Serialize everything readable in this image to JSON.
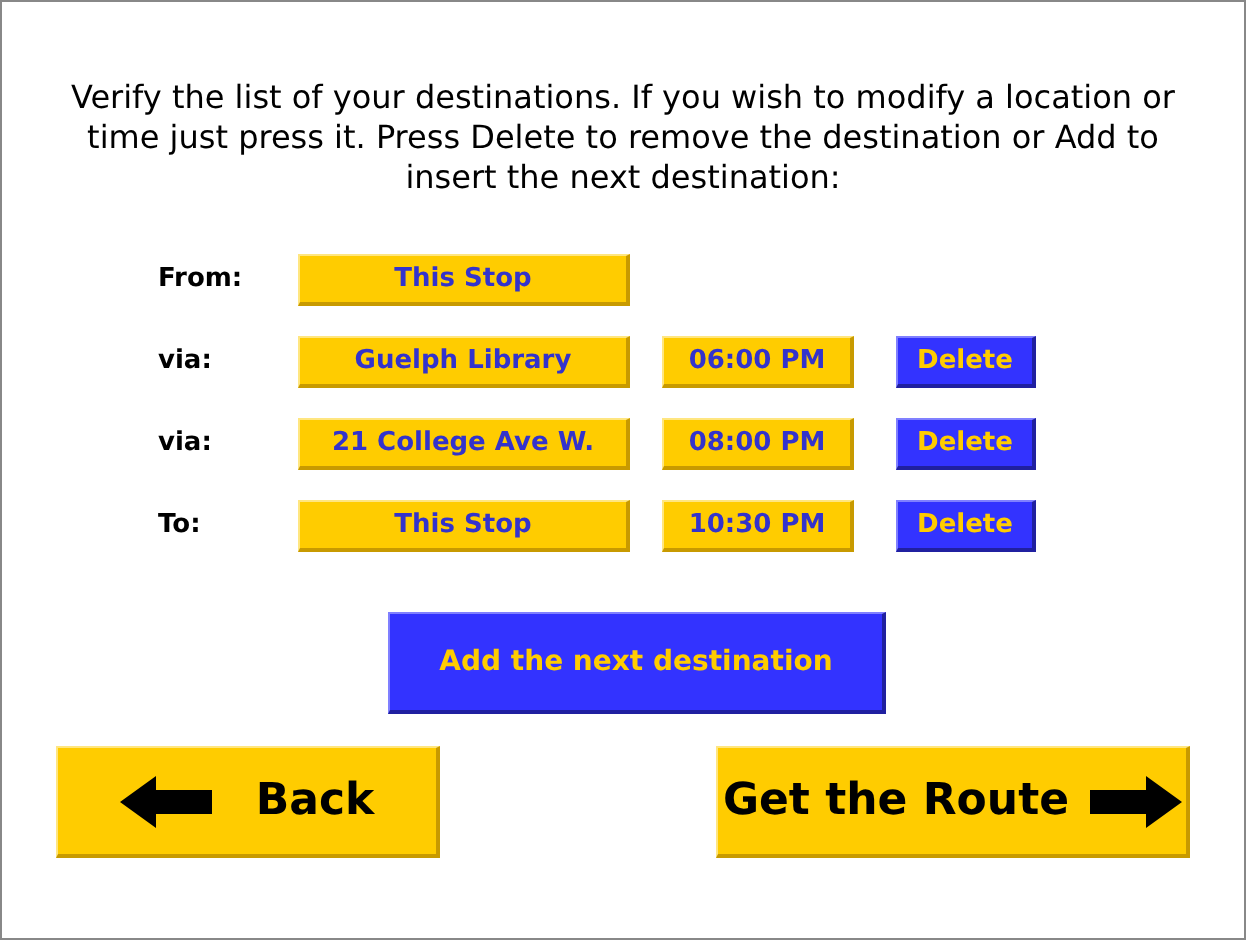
{
  "instructions": "Verify the list of your destinations. If you wish to modify a location or time just press it. Press Delete to remove the destination or Add to insert the next destination:",
  "stops": [
    {
      "label": "From:",
      "place": "This Stop"
    },
    {
      "label": "via:",
      "place": "Guelph Library",
      "time": "06:00 PM",
      "delete": "Delete"
    },
    {
      "label": "via:",
      "place": "21 College Ave W.",
      "time": "08:00 PM",
      "delete": "Delete"
    },
    {
      "label": "To:",
      "place": "This Stop",
      "time": "10:30 PM",
      "delete": "Delete"
    }
  ],
  "add_button": "Add the next destination",
  "back_button": "Back",
  "next_button": "Get the Route"
}
